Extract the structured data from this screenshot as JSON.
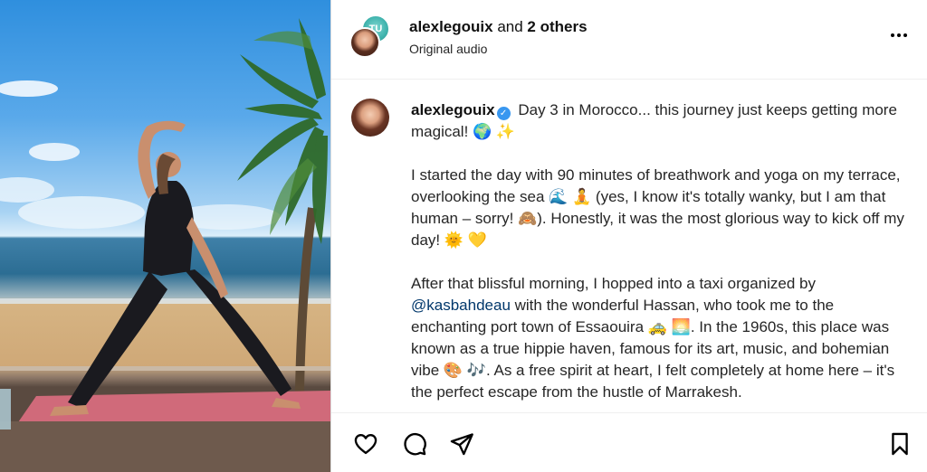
{
  "header": {
    "username": "alexlegouix",
    "collab_joiner": " and ",
    "others": "2 others",
    "audio": "Original audio",
    "collab_avatar_text": "TU"
  },
  "caption": {
    "username": "alexlegouix",
    "p1": "Day 3 in Morocco... this journey just keeps getting more magical! 🌍 ✨",
    "p2": "I started the day with 90 minutes of breathwork and yoga on my terrace, overlooking the sea 🌊 🧘 (yes, I know it's totally wanky, but I am that human – sorry! 🙈). Honestly, it was the most glorious way to kick off my day! 🌞 💛",
    "p3_before": "After that blissful morning, I hopped into a taxi organized by ",
    "p3_mention": "@kasbahdeau",
    "p3_after": " with the wonderful Hassan, who took me to the enchanting port town of Essaouira 🚕 🌅. In the 1960s, this place was known as a true hippie haven, famous for its art, music, and bohemian vibe 🎨 🎶. As a free spirit at heart, I felt completely at home here – it's the perfect escape from the hustle of Marrakesh.",
    "p4": "🚀 ✨"
  },
  "icons": {
    "like": "heart-icon",
    "comment": "comment-icon",
    "share": "paper-plane-icon",
    "save": "bookmark-icon",
    "more": "more-options-icon",
    "verified": "verified-badge-icon"
  },
  "colors": {
    "mention": "#00376b",
    "verified": "#3897f0",
    "border": "#dbdbdb"
  }
}
